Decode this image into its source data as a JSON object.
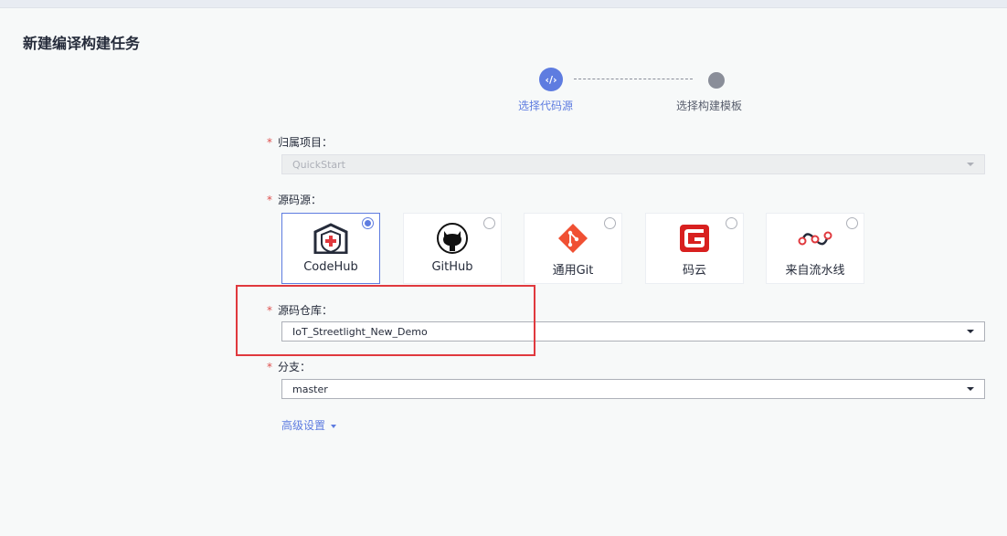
{
  "page": {
    "title": "新建编译构建任务"
  },
  "steps": [
    {
      "icon": "code-icon",
      "icon_text": "‹/›",
      "label": "选择代码源",
      "active": true
    },
    {
      "icon": "step-dot",
      "label": "选择构建模板",
      "active": false
    }
  ],
  "form": {
    "project": {
      "label": "归属项目：",
      "value": "QuickStart",
      "disabled": true
    },
    "source": {
      "label": "源码源：",
      "options": [
        {
          "name": "CodeHub",
          "icon": "codehub-icon",
          "selected": true
        },
        {
          "name": "GitHub",
          "icon": "github-icon",
          "selected": false
        },
        {
          "name": "通用Git",
          "icon": "git-icon",
          "selected": false
        },
        {
          "name": "码云",
          "icon": "gitee-icon",
          "selected": false
        },
        {
          "name": "来自流水线",
          "icon": "pipeline-icon",
          "selected": false
        }
      ]
    },
    "repo": {
      "label": "源码仓库：",
      "value": "IoT_Streetlight_New_Demo"
    },
    "branch": {
      "label": "分支：",
      "value": "master"
    },
    "advanced": {
      "label": "高级设置"
    },
    "required_mark": "*"
  },
  "colors": {
    "accent": "#5e7ce0",
    "required": "#de504e",
    "highlight": "#e0393e"
  }
}
